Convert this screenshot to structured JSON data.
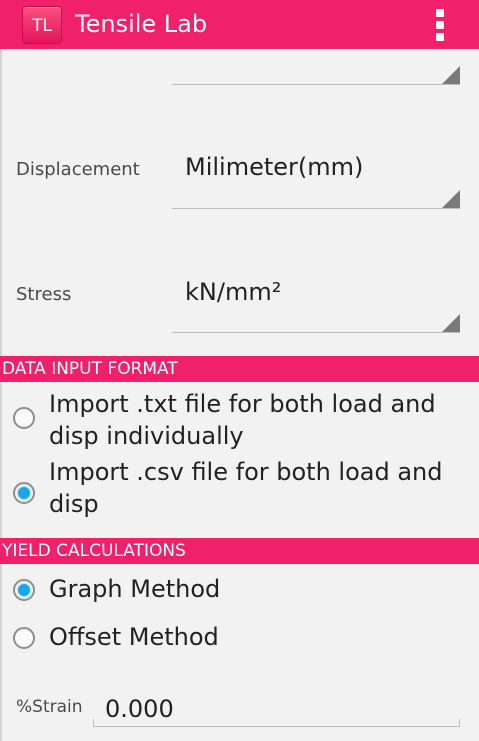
{
  "app": {
    "icon_text": "TL",
    "title": "Tensile Lab",
    "menu_icon": "overflow-menu-icon",
    "accent_color": "#f0206a"
  },
  "units": {
    "displacement": {
      "label": "Displacement",
      "value": "Milimeter(mm)"
    },
    "stress": {
      "label": "Stress",
      "value": "kN/mm²"
    }
  },
  "data_input": {
    "header": "DATA INPUT FORMAT",
    "options": [
      {
        "line1": "Import .txt file for both load and",
        "line2": "disp individually",
        "checked": false
      },
      {
        "line1": "Import .csv file for both load and",
        "line2": "disp",
        "checked": true
      }
    ]
  },
  "yield": {
    "header": "YIELD CALCULATIONS",
    "options": [
      {
        "label": "Graph Method",
        "checked": true
      },
      {
        "label": "Offset Method",
        "checked": false
      }
    ],
    "strain_label": "%Strain",
    "strain_value": "0.000"
  }
}
